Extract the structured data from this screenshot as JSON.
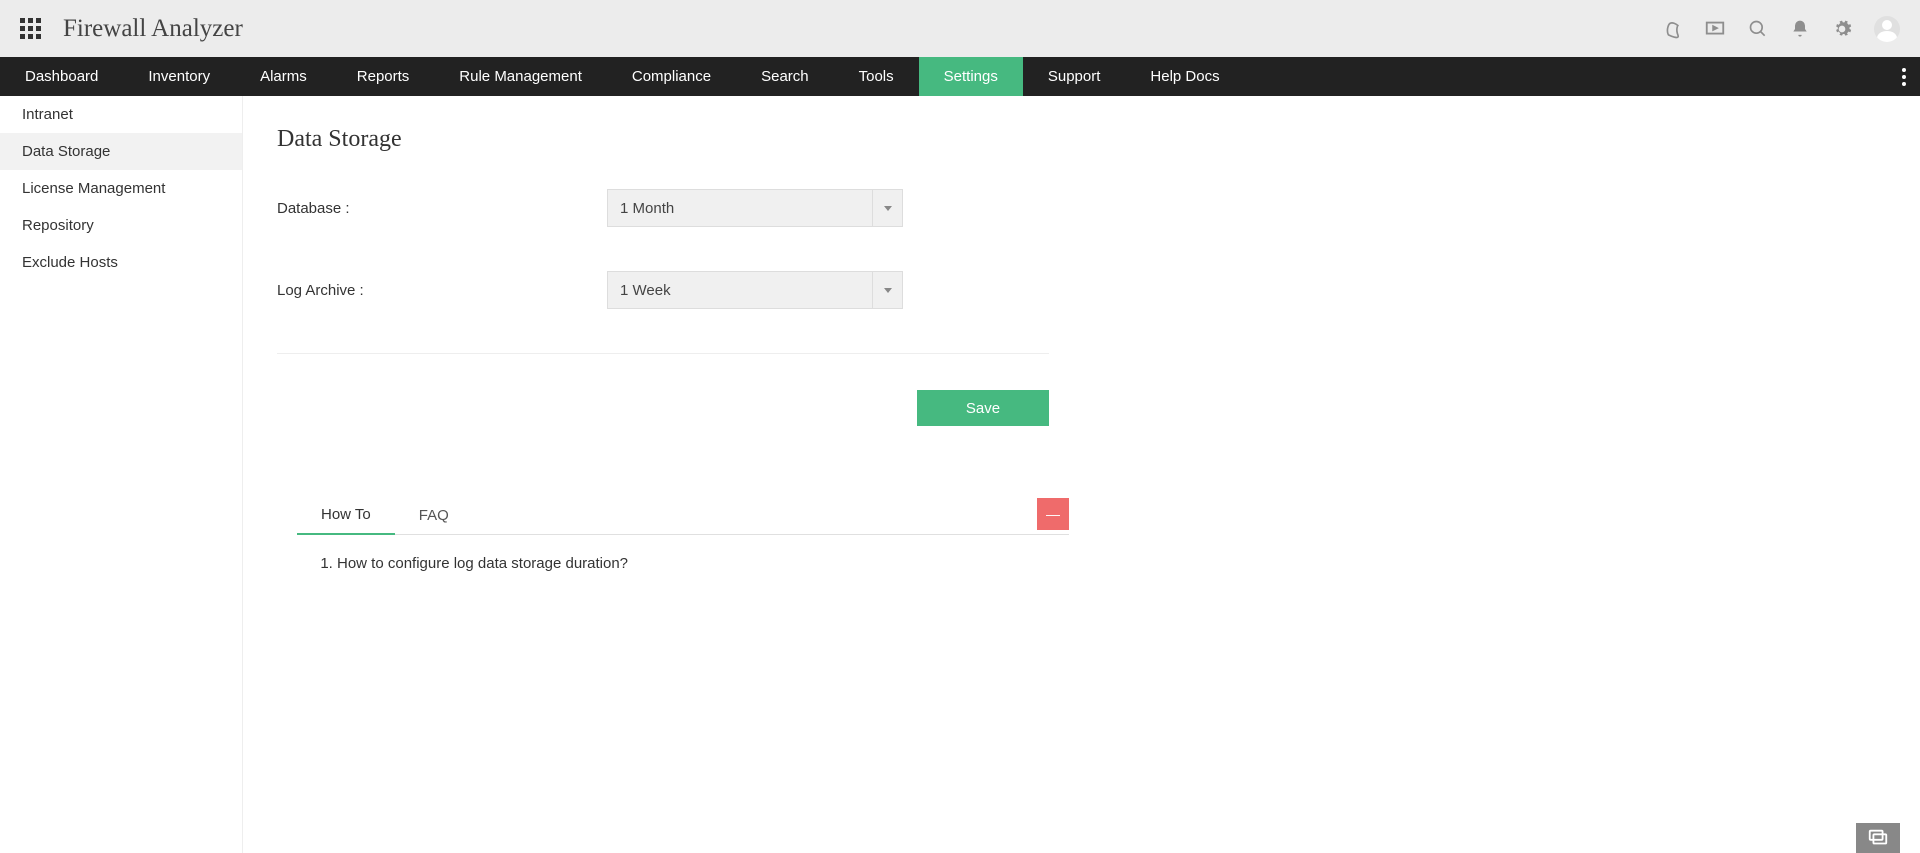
{
  "header": {
    "title": "Firewall Analyzer"
  },
  "nav": {
    "items": [
      {
        "label": "Dashboard",
        "active": false
      },
      {
        "label": "Inventory",
        "active": false
      },
      {
        "label": "Alarms",
        "active": false
      },
      {
        "label": "Reports",
        "active": false
      },
      {
        "label": "Rule Management",
        "active": false
      },
      {
        "label": "Compliance",
        "active": false
      },
      {
        "label": "Search",
        "active": false
      },
      {
        "label": "Tools",
        "active": false
      },
      {
        "label": "Settings",
        "active": true
      },
      {
        "label": "Support",
        "active": false
      },
      {
        "label": "Help Docs",
        "active": false
      }
    ]
  },
  "sidebar": {
    "items": [
      {
        "label": "Intranet",
        "active": false
      },
      {
        "label": "Data Storage",
        "active": true
      },
      {
        "label": "License Management",
        "active": false
      },
      {
        "label": "Repository",
        "active": false
      },
      {
        "label": "Exclude Hosts",
        "active": false
      }
    ]
  },
  "main": {
    "title": "Data Storage",
    "fields": {
      "database": {
        "label": "Database :",
        "value": "1 Month"
      },
      "log_archive": {
        "label": "Log Archive :",
        "value": "1 Week"
      }
    },
    "save_label": "Save"
  },
  "help": {
    "tabs": [
      {
        "label": "How To",
        "active": true
      },
      {
        "label": "FAQ",
        "active": false
      }
    ],
    "items": [
      "How to configure log data storage duration?"
    ],
    "collapse_glyph": "—"
  }
}
